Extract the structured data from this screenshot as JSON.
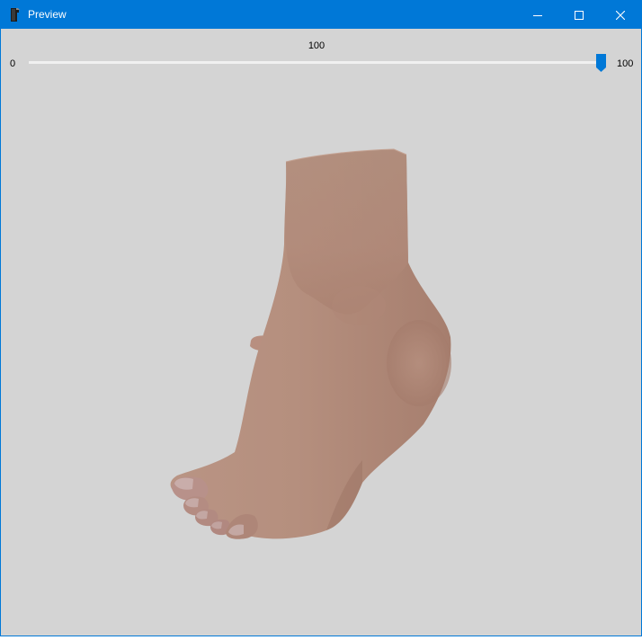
{
  "window": {
    "title": "Preview",
    "titlebar_color": "#0078d7",
    "background_color": "#d4d4d4"
  },
  "titlebar": {
    "app_icon": "app-icon",
    "minimize_icon": "minimize-icon",
    "maximize_icon": "maximize-icon",
    "close_icon": "close-icon"
  },
  "slider": {
    "current_label": "100",
    "min_label": "0",
    "max_label": "100",
    "min": 0,
    "max": 100,
    "value": 100,
    "accent_color": "#0078d7"
  },
  "viewport": {
    "model": "foot-3d-model"
  }
}
